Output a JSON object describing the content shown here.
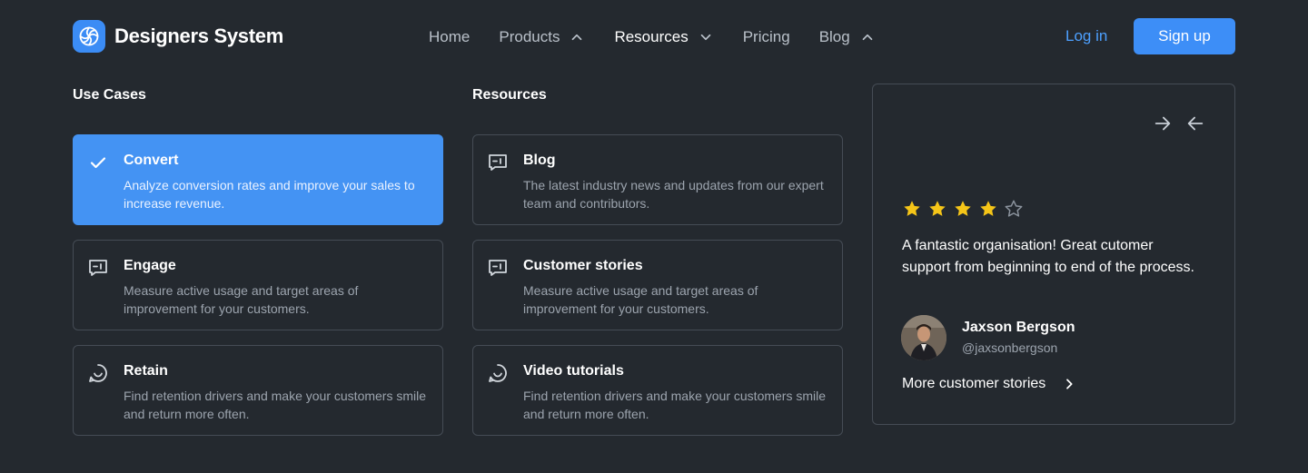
{
  "brand": {
    "name": "Designers System",
    "logo_icon": "aperture-icon",
    "accent": "#3d8ef7"
  },
  "nav": {
    "items": [
      {
        "label": "Home",
        "chevron": ""
      },
      {
        "label": "Products",
        "chevron": "up"
      },
      {
        "label": "Resources",
        "chevron": "down"
      },
      {
        "label": "Pricing",
        "chevron": ""
      },
      {
        "label": "Blog",
        "chevron": "up"
      }
    ],
    "login_label": "Log in",
    "signup_label": "Sign up"
  },
  "use_cases": {
    "title": "Use Cases",
    "items": [
      {
        "title": "Convert",
        "desc": "Analyze conversion rates and improve your sales to increase revenue.",
        "icon": "check-icon",
        "selected": true
      },
      {
        "title": "Engage",
        "desc": "Measure active usage and target areas of improvement for your customers.",
        "icon": "message-plus-icon",
        "selected": false
      },
      {
        "title": "Retain",
        "desc": "Find retention drivers and make your customers smile and return more often.",
        "icon": "smile-chat-icon",
        "selected": false
      }
    ]
  },
  "resources": {
    "title": "Resources",
    "items": [
      {
        "title": "Blog",
        "desc": "The latest industry news and updates from our expert team and contributors.",
        "icon": "message-plus-icon"
      },
      {
        "title": "Customer stories",
        "desc": "Measure active usage and target areas of improvement for your customers.",
        "icon": "message-plus-icon"
      },
      {
        "title": "Video tutorials",
        "desc": "Find retention drivers and make your customers smile and return more often.",
        "icon": "smile-chat-icon"
      }
    ]
  },
  "testimonial": {
    "rating": 4,
    "max_rating": 5,
    "quote": "A fantastic organisation! Great cutomer support from beginning to end of the process.",
    "author_name": "Jaxson Bergson",
    "author_handle": "@jaxsonbergson",
    "more_label": "More customer stories",
    "star_color": "#f5c518"
  }
}
